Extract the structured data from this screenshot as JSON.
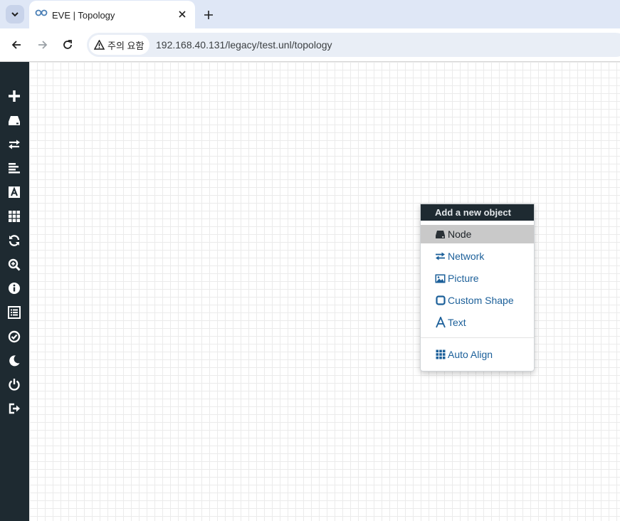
{
  "browser": {
    "tab_title": "EVE | Topology",
    "security_label": "주의 요함",
    "url": "192.168.40.131/legacy/test.unl/topology"
  },
  "sidebar": {
    "items": [
      {
        "icon": "plus-icon"
      },
      {
        "icon": "node-hdd-icon"
      },
      {
        "icon": "exchange-icon"
      },
      {
        "icon": "align-left-icon"
      },
      {
        "icon": "text-icon"
      },
      {
        "icon": "grid-icon"
      },
      {
        "icon": "refresh-icon"
      },
      {
        "icon": "zoom-in-icon"
      },
      {
        "icon": "info-icon"
      },
      {
        "icon": "list-icon"
      },
      {
        "icon": "check-circle-icon"
      },
      {
        "icon": "moon-icon"
      },
      {
        "icon": "power-icon"
      },
      {
        "icon": "logout-icon"
      }
    ]
  },
  "menu": {
    "header": "Add a new object",
    "items": [
      {
        "label": "Node",
        "icon": "node-icon",
        "active": true
      },
      {
        "label": "Network",
        "icon": "network-icon"
      },
      {
        "label": "Picture",
        "icon": "picture-icon"
      },
      {
        "label": "Custom Shape",
        "icon": "shape-icon"
      },
      {
        "label": "Text",
        "icon": "text-icon"
      },
      {
        "label": "Auto Align",
        "icon": "grid-icon"
      }
    ]
  },
  "colors": {
    "sidebar_bg": "#1e2a31",
    "menu_link": "#1b5f99",
    "menu_active_bg": "#c9c9c9"
  }
}
